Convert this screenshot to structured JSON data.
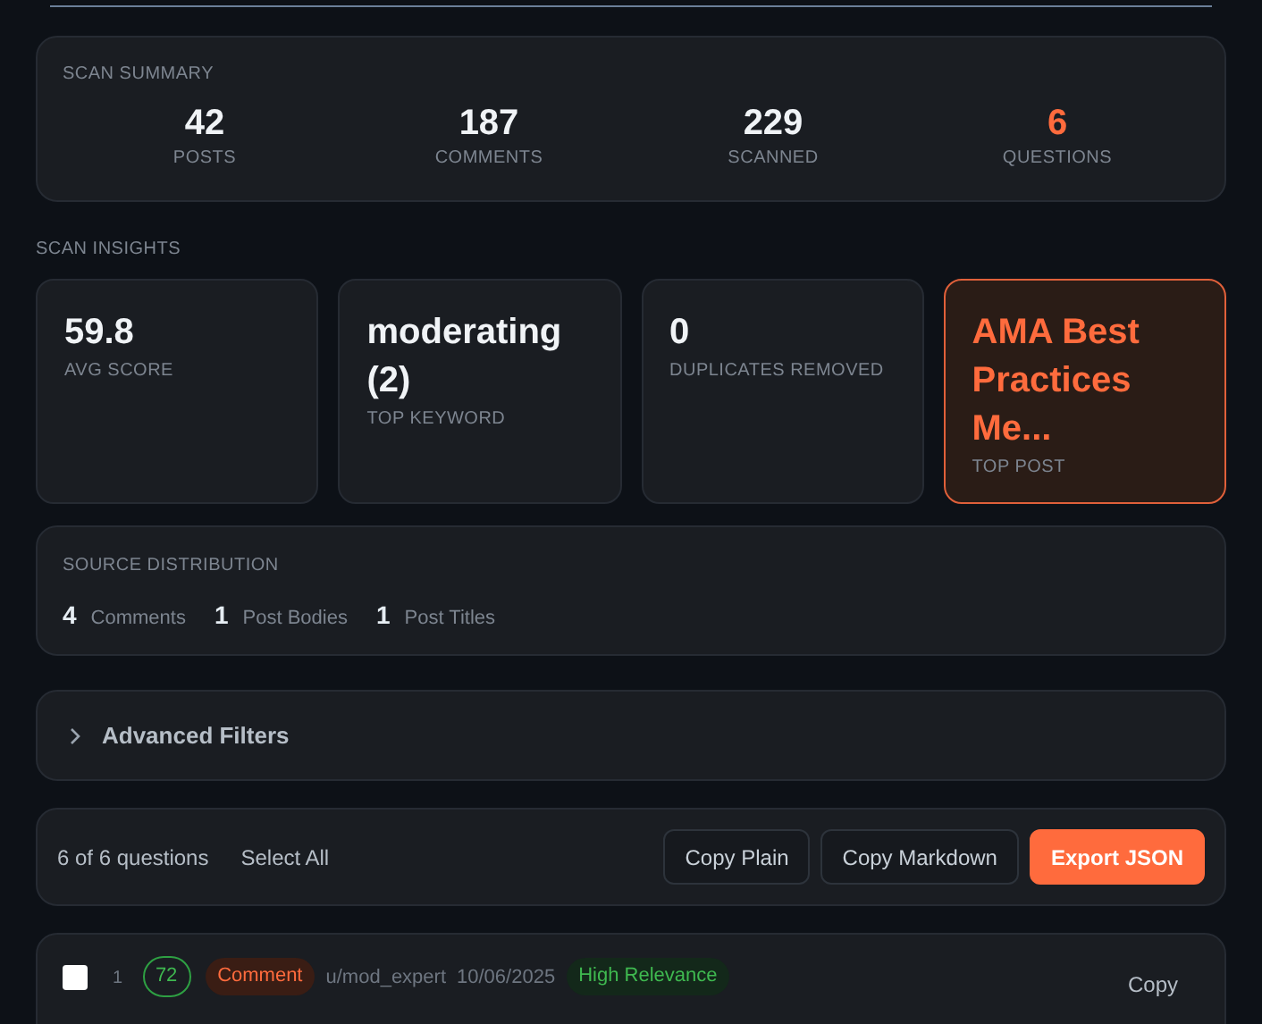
{
  "scan_summary": {
    "title": "SCAN SUMMARY",
    "stats": [
      {
        "value": "42",
        "label": "POSTS",
        "kind": "normal"
      },
      {
        "value": "187",
        "label": "COMMENTS",
        "kind": "normal"
      },
      {
        "value": "229",
        "label": "SCANNED",
        "kind": "normal"
      },
      {
        "value": "6",
        "label": "QUESTIONS",
        "kind": "accent"
      }
    ]
  },
  "scan_insights": {
    "title": "SCAN INSIGHTS",
    "cards": [
      {
        "value": "59.8",
        "label": "AVG SCORE",
        "kind": "normal"
      },
      {
        "value": "moderating (2)",
        "label": "TOP KEYWORD",
        "kind": "normal"
      },
      {
        "value": "0",
        "label": "DUPLICATES REMOVED",
        "kind": "normal"
      },
      {
        "value": "AMA Best Practices Me...",
        "label": "TOP POST",
        "kind": "accent"
      }
    ]
  },
  "source_distribution": {
    "title": "SOURCE DISTRIBUTION",
    "items": [
      {
        "count": "4",
        "label": "Comments"
      },
      {
        "count": "1",
        "label": "Post Bodies"
      },
      {
        "count": "1",
        "label": "Post Titles"
      }
    ]
  },
  "advanced_filters": {
    "label": "Advanced Filters",
    "expanded": false
  },
  "toolbar": {
    "count": "6 of 6 questions",
    "select_all": "Select All",
    "buttons": [
      {
        "label": "Copy Plain",
        "kind": "secondary"
      },
      {
        "label": "Copy Markdown",
        "kind": "secondary"
      },
      {
        "label": "Export JSON",
        "kind": "primary"
      }
    ]
  },
  "questions": [
    {
      "checked": false,
      "index": "1",
      "score": "72",
      "source": "Comment",
      "author": "u/mod_expert",
      "date": "10/06/2025",
      "relevance": "High Relevance",
      "copy": "Copy"
    }
  ]
}
